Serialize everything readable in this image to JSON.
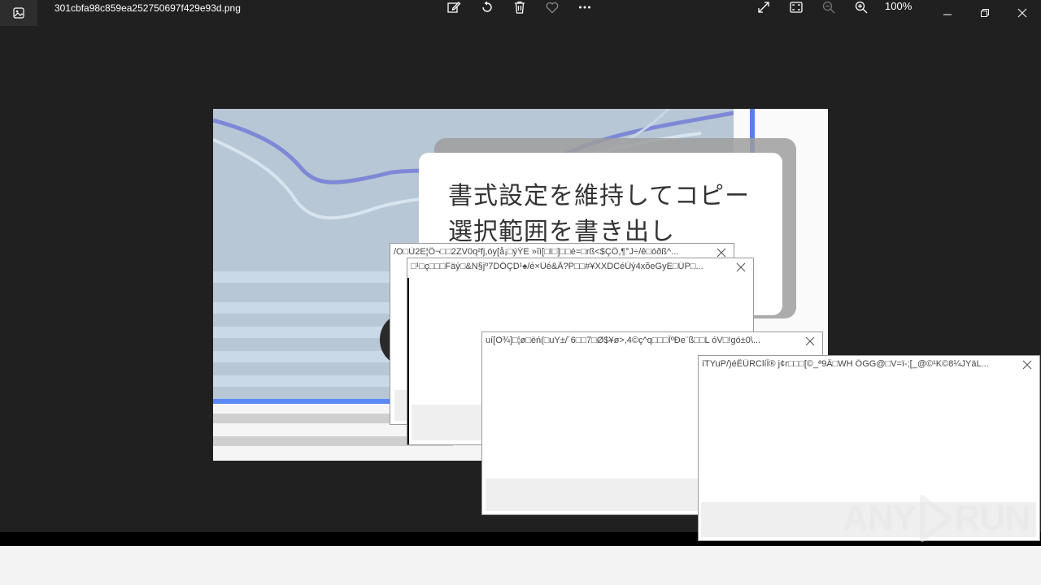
{
  "titlebar": {
    "filename": "301cbfa98c859ea252750697f429e93d.png",
    "zoom_level": "100%",
    "icons": [
      "photos-app-icon",
      "edit-image-icon",
      "rotate-icon",
      "delete-icon",
      "favorite-icon",
      "more-icon",
      "fullscreen-icon",
      "fit-to-window-icon",
      "zoom-out-icon",
      "zoom-in-icon",
      "minimize-icon",
      "restore-icon",
      "close-icon"
    ]
  },
  "image": {
    "line1": "書式設定を維持してコピー",
    "line2": "選択範囲を書き出し"
  },
  "dialogs": [
    {
      "title": "/O□Ù2E¦Ö¬□□2ZV0q²fj,óy[å¡□ýÝE »îì[□I□]□□é=□rß<$ÇÖ,¶°J÷/ê□óðß^..."
    },
    {
      "title": "□¹□ç□□□Fäý□&N§jº7DÖÇD¹♠/é×Üé&Ã?P□□#¥XXDCéÜý4xõeGyE□ÜP□..."
    },
    {
      "title": "uí[O¾]□¦ø□ëń(□uY±/´6□□7□Ø$¥ø>,4©ç^q□□□ÎºÐe¨ß□□L óV□!gó±0\\..."
    },
    {
      "title": "íTYuP/)éÊÜRClíÎ® j¢r□□□[©_ª9Â□WH  ÔGG@□V=ï-;[_@©¹K©8¼JYäL..."
    }
  ],
  "watermark": {
    "left": "ANY",
    "right": "RUN"
  }
}
